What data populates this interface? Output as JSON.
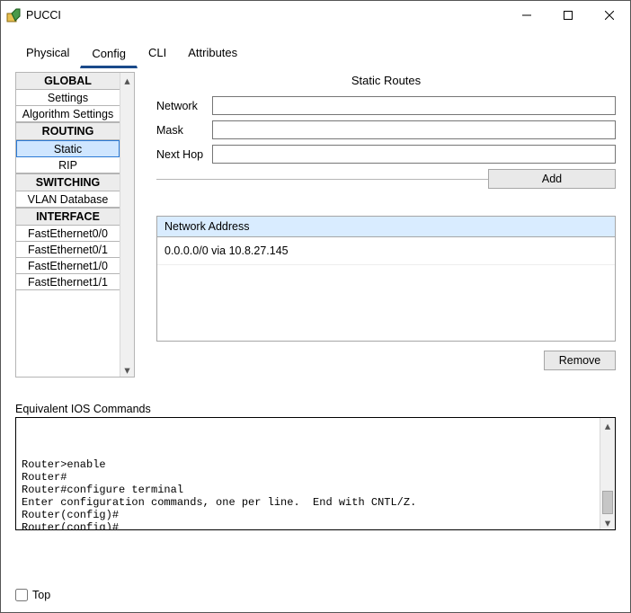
{
  "window": {
    "title": "PUCCI"
  },
  "tabs": [
    "Physical",
    "Config",
    "CLI",
    "Attributes"
  ],
  "active_tab": "Config",
  "sidebar": [
    {
      "type": "header",
      "label": "GLOBAL"
    },
    {
      "type": "item",
      "label": "Settings"
    },
    {
      "type": "item",
      "label": "Algorithm Settings"
    },
    {
      "type": "header",
      "label": "ROUTING"
    },
    {
      "type": "item",
      "label": "Static",
      "selected": true
    },
    {
      "type": "item",
      "label": "RIP"
    },
    {
      "type": "header",
      "label": "SWITCHING"
    },
    {
      "type": "item",
      "label": "VLAN Database"
    },
    {
      "type": "header",
      "label": "INTERFACE"
    },
    {
      "type": "item",
      "label": "FastEthernet0/0"
    },
    {
      "type": "item",
      "label": "FastEthernet0/1"
    },
    {
      "type": "item",
      "label": "FastEthernet1/0"
    },
    {
      "type": "item",
      "label": "FastEthernet1/1"
    }
  ],
  "panel": {
    "title": "Static Routes",
    "fields": {
      "network_label": "Network",
      "network_value": "",
      "mask_label": "Mask",
      "mask_value": "",
      "nexthop_label": "Next Hop",
      "nexthop_value": ""
    },
    "add_label": "Add",
    "table_header": "Network Address",
    "entries": [
      "0.0.0.0/0 via 10.8.27.145"
    ],
    "remove_label": "Remove"
  },
  "ios": {
    "label": "Equivalent IOS Commands",
    "text": "\n\n\nRouter>enable\nRouter#\nRouter#configure terminal\nEnter configuration commands, one per line.  End with CNTL/Z.\nRouter(config)#\nRouter(config)#"
  },
  "footer": {
    "top_label": "Top",
    "top_checked": false
  }
}
